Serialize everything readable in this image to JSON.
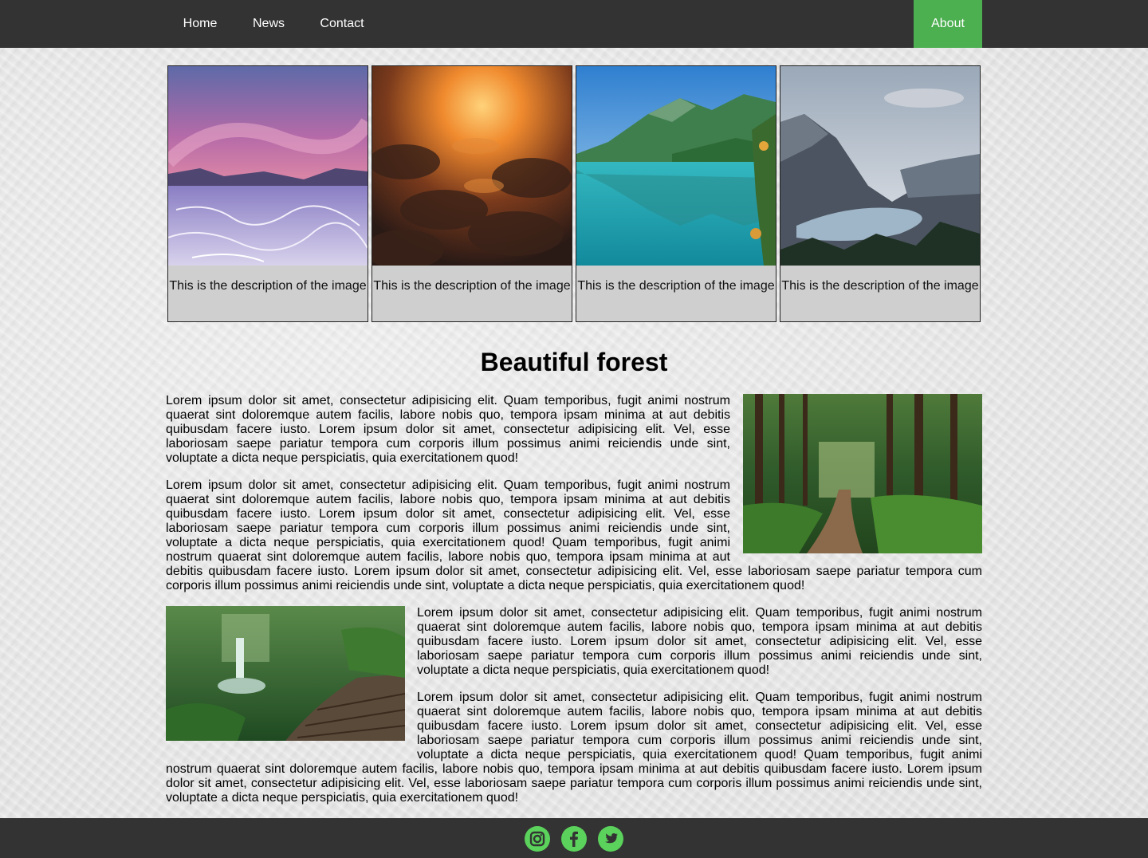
{
  "nav": {
    "items": [
      {
        "label": "Home"
      },
      {
        "label": "News"
      },
      {
        "label": "Contact"
      },
      {
        "label": "About",
        "active": true
      }
    ],
    "active_color": "#4caf50",
    "background": "#333333"
  },
  "gallery": {
    "cards": [
      {
        "image": "salt-flat-sunset",
        "description": "This is the description of the image"
      },
      {
        "image": "clouds-sunset",
        "description": "This is the description of the image"
      },
      {
        "image": "turquoise-mountain-lake",
        "description": "This is the description of the image"
      },
      {
        "image": "mountain-lake-valley",
        "description": "This is the description of the image"
      }
    ]
  },
  "article": {
    "title": "Beautiful forest",
    "images": [
      "forest-path",
      "forest-waterfall-boardwalk"
    ],
    "paragraphs": [
      "Lorem ipsum dolor sit amet, consectetur adipisicing elit. Quam temporibus, fugit animi nostrum quaerat sint doloremque autem facilis, labore nobis quo, tempora ipsam minima at aut debitis quibusdam facere iusto. Lorem ipsum dolor sit amet, consectetur adipisicing elit. Vel, esse laboriosam saepe pariatur tempora cum corporis illum possimus animi reiciendis unde sint, voluptate a dicta neque perspiciatis, quia exercitationem quod!",
      "Lorem ipsum dolor sit amet, consectetur adipisicing elit. Quam temporibus, fugit animi nostrum quaerat sint doloremque autem facilis, labore nobis quo, tempora ipsam minima at aut debitis quibusdam facere iusto. Lorem ipsum dolor sit amet, consectetur adipisicing elit. Vel, esse laboriosam saepe pariatur tempora cum corporis illum possimus animi reiciendis unde sint, voluptate a dicta neque perspiciatis, quia exercitationem quod! Quam temporibus, fugit animi nostrum quaerat sint doloremque autem facilis, labore nobis quo, tempora ipsam minima at aut debitis quibusdam facere iusto. Lorem ipsum dolor sit amet, consectetur adipisicing elit. Vel, esse laboriosam saepe pariatur tempora cum corporis illum possimus animi reiciendis unde sint, voluptate a dicta neque perspiciatis, quia exercitationem quod!",
      "Lorem ipsum dolor sit amet, consectetur adipisicing elit. Quam temporibus, fugit animi nostrum quaerat sint doloremque autem facilis, labore nobis quo, tempora ipsam minima at aut debitis quibusdam facere iusto. Lorem ipsum dolor sit amet, consectetur adipisicing elit. Vel, esse laboriosam saepe pariatur tempora cum corporis illum possimus animi reiciendis unde sint, voluptate a dicta neque perspiciatis, quia exercitationem quod!",
      "Lorem ipsum dolor sit amet, consectetur adipisicing elit. Quam temporibus, fugit animi nostrum quaerat sint doloremque autem facilis, labore nobis quo, tempora ipsam minima at aut debitis quibusdam facere iusto. Lorem ipsum dolor sit amet, consectetur adipisicing elit. Vel, esse laboriosam saepe pariatur tempora cum corporis illum possimus animi reiciendis unde sint, voluptate a dicta neque perspiciatis, quia exercitationem quod! Quam temporibus, fugit animi nostrum quaerat sint doloremque autem facilis, labore nobis quo, tempora ipsam minima at aut debitis quibusdam facere iusto. Lorem ipsum dolor sit amet, consectetur adipisicing elit. Vel, esse laboriosam saepe pariatur tempora cum corporis illum possimus animi reiciendis unde sint, voluptate a dicta neque perspiciatis, quia exercitationem quod!"
    ]
  },
  "footer": {
    "social": [
      "instagram-icon",
      "facebook-icon",
      "twitter-icon"
    ],
    "icon_color": "#5bd25b"
  }
}
